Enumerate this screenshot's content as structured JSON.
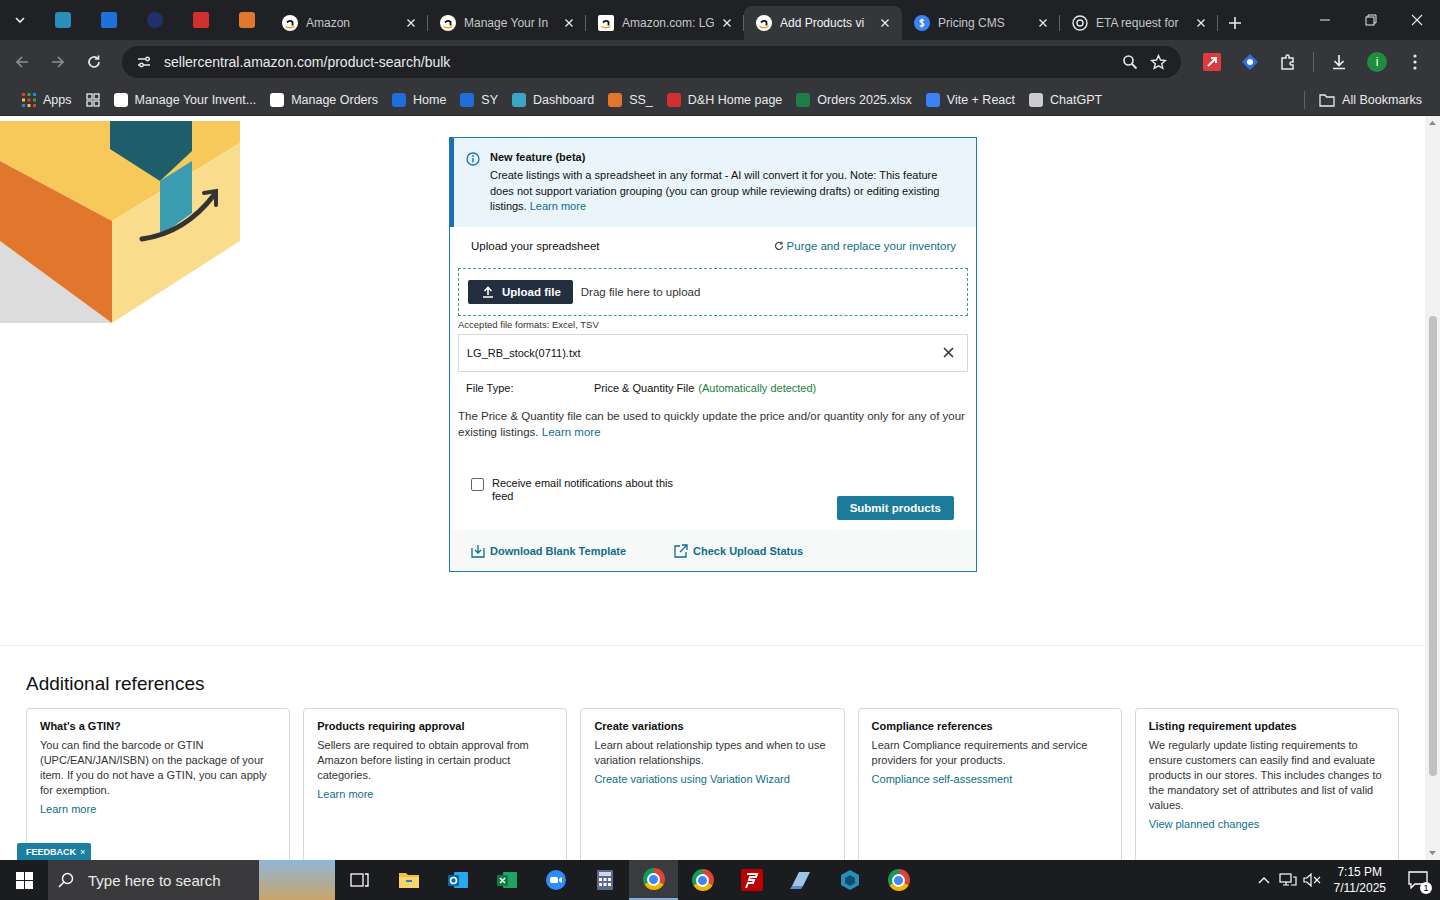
{
  "browser": {
    "tabs": [
      {
        "label": "Amazon",
        "selected": false
      },
      {
        "label": "Manage Your In",
        "selected": false
      },
      {
        "label": "Amazon.com: LG",
        "selected": false
      },
      {
        "label": "Add Products vi",
        "selected": true
      },
      {
        "label": "Pricing CMS",
        "selected": false
      },
      {
        "label": "ETA request for",
        "selected": false
      }
    ],
    "address": "sellercentral.amazon.com/product-search/bulk",
    "profile_initial": "i",
    "bookmarks": [
      {
        "label": "Apps"
      },
      {
        "label": "Manage Your Invent..."
      },
      {
        "label": "Manage Orders"
      },
      {
        "label": "Home"
      },
      {
        "label": "SY"
      },
      {
        "label": "Dashboard"
      },
      {
        "label": "SS_"
      },
      {
        "label": "D&H Home page"
      },
      {
        "label": "Orders 2025.xlsx"
      },
      {
        "label": "Vite + React"
      },
      {
        "label": "ChatGPT"
      }
    ],
    "all_bookmarks": "All Bookmarks"
  },
  "notice": {
    "title": "New feature (beta)",
    "text": "Create listings with a spreadsheet in any format - AI will convert it for you. Note: This feature does not support variation grouping (you can group while reviewing drafts) or editing existing listings.",
    "link": "Learn more"
  },
  "upload": {
    "heading": "Upload your spreadsheet",
    "purge_link": "Purge and replace your inventory",
    "button": "Upload file",
    "drop_hint": "Drag file here to upload",
    "formats": "Accepted file formats: Excel, TSV",
    "file_name": "LG_RB_stock(0711).txt",
    "file_type_label": "File Type:",
    "file_type": "Price & Quantity File",
    "detection": "(Automatically detected)",
    "description": "The Price & Quantity file can be used to quickly update the price and/or quantity only for any of your existing listings.",
    "description_link": "Learn more",
    "email_option": {
      "label": "Receive email notifications about this feed",
      "checked": false
    },
    "submit": "Submit products",
    "footer_links": [
      "Download Blank Template",
      "Check Upload Status"
    ]
  },
  "references": {
    "heading": "Additional references",
    "cards": [
      {
        "title": "What's a GTIN?",
        "text": "You can find the barcode or GTIN (UPC/EAN/JAN/ISBN) on the package of your item. If you do not have a GTIN, you can apply for exemption.",
        "link": "Learn more"
      },
      {
        "title": "Products requiring approval",
        "text": "Sellers are required to obtain approval from Amazon before listing in certain product categories.",
        "link": "Learn more"
      },
      {
        "title": "Create variations",
        "text": "Learn about relationship types and when to use variation relationships.",
        "link": "Create variations using Variation Wizard"
      },
      {
        "title": "Compliance references",
        "text": "Learn Compliance requirements and service providers for your products.",
        "link": "Compliance self-assessment"
      },
      {
        "title": "Listing requirement updates",
        "text": "We regularly update listing requirements to ensure customers can easily find and evaluate products in our stores. This includes changes to the mandatory set of attributes and list of valid values.",
        "link": "View planned changes"
      }
    ]
  },
  "feedback": {
    "label": "FEEDBACK",
    "close": "×"
  },
  "taskbar": {
    "search_placeholder": "Type here to search",
    "time": "7:15 PM",
    "date": "7/11/2025",
    "notifications": "1"
  }
}
